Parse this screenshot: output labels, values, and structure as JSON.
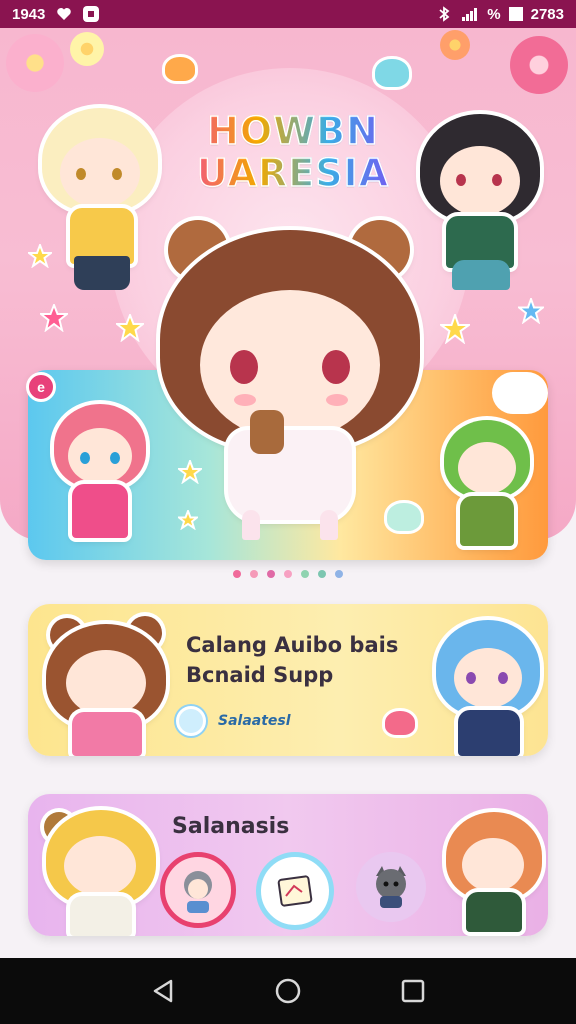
{
  "status_bar": {
    "time": "1943",
    "right_text": "%",
    "right_clock": "2783",
    "icons": [
      "heart-icon",
      "notification-icon",
      "bluetooth-icon",
      "signal-icon",
      "battery-icon"
    ]
  },
  "hero": {
    "logo_line1": "HOWBN",
    "logo_line2": "UARESIA",
    "badge": "e"
  },
  "carousel": {
    "dot_colors": [
      "#f06a9a",
      "#f59ab8",
      "#e06aa6",
      "#f7a1c2",
      "#8fd3b0",
      "#7cc6b0",
      "#8fb3e6"
    ]
  },
  "support_card": {
    "title_line1": "Calang Auibo bais",
    "title_line2": "Bcnaid Supp",
    "link_text": "Salaatesl"
  },
  "sal_card": {
    "title": "Salanasis"
  },
  "colors": {
    "status_bar": "#8a1450",
    "hero_pink": "#f8bdd3",
    "support_yellow": "#fde58e",
    "sal_purple": "#e8b4ee"
  },
  "nav": {
    "back": "back-icon",
    "home": "home-icon",
    "recents": "recents-icon"
  }
}
